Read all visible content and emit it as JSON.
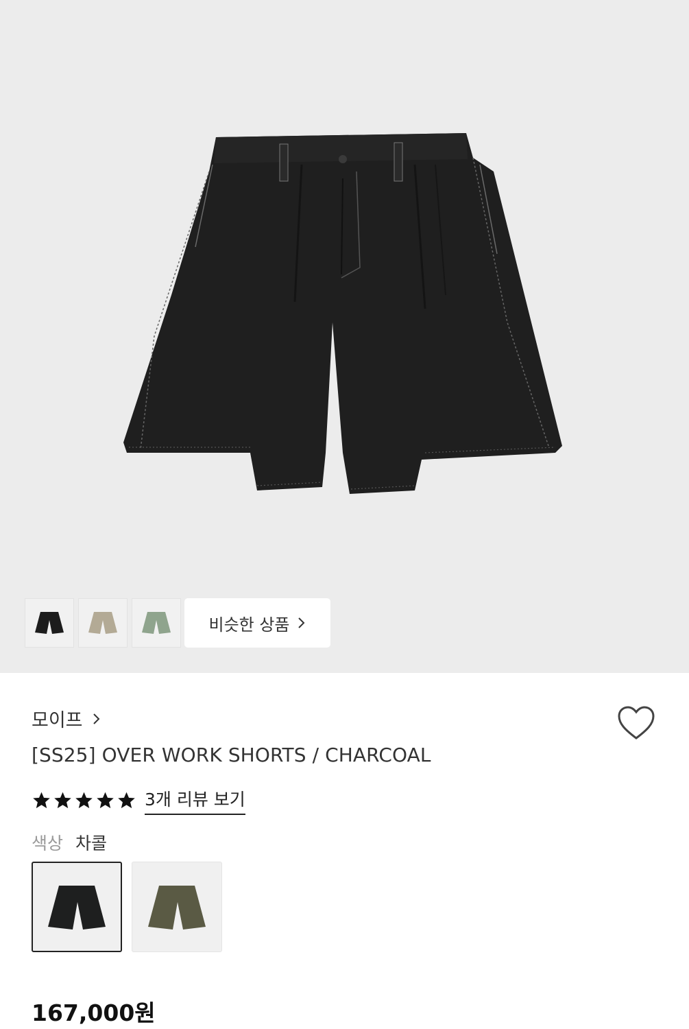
{
  "gallery": {
    "similar_button_label": "비슷한 상품",
    "thumbnails": [
      {
        "color": "#1c1c1c"
      },
      {
        "color": "#b3aa95"
      },
      {
        "color": "#8fa48d"
      }
    ]
  },
  "product": {
    "brand": "모이프",
    "title": "[SS25] OVER WORK SHORTS / CHARCOAL",
    "rating": 5,
    "review_link": "3개 리뷰 보기",
    "color_label": "색상",
    "color_value": "차콜",
    "price": "167,000원",
    "color_options": [
      {
        "color": "#1e1f1f",
        "selected": true
      },
      {
        "color": "#5a5a44",
        "selected": false
      }
    ]
  },
  "colors": {
    "hero_bg": "#ececec",
    "shorts": "#1f1f1f",
    "text": "#333333"
  }
}
